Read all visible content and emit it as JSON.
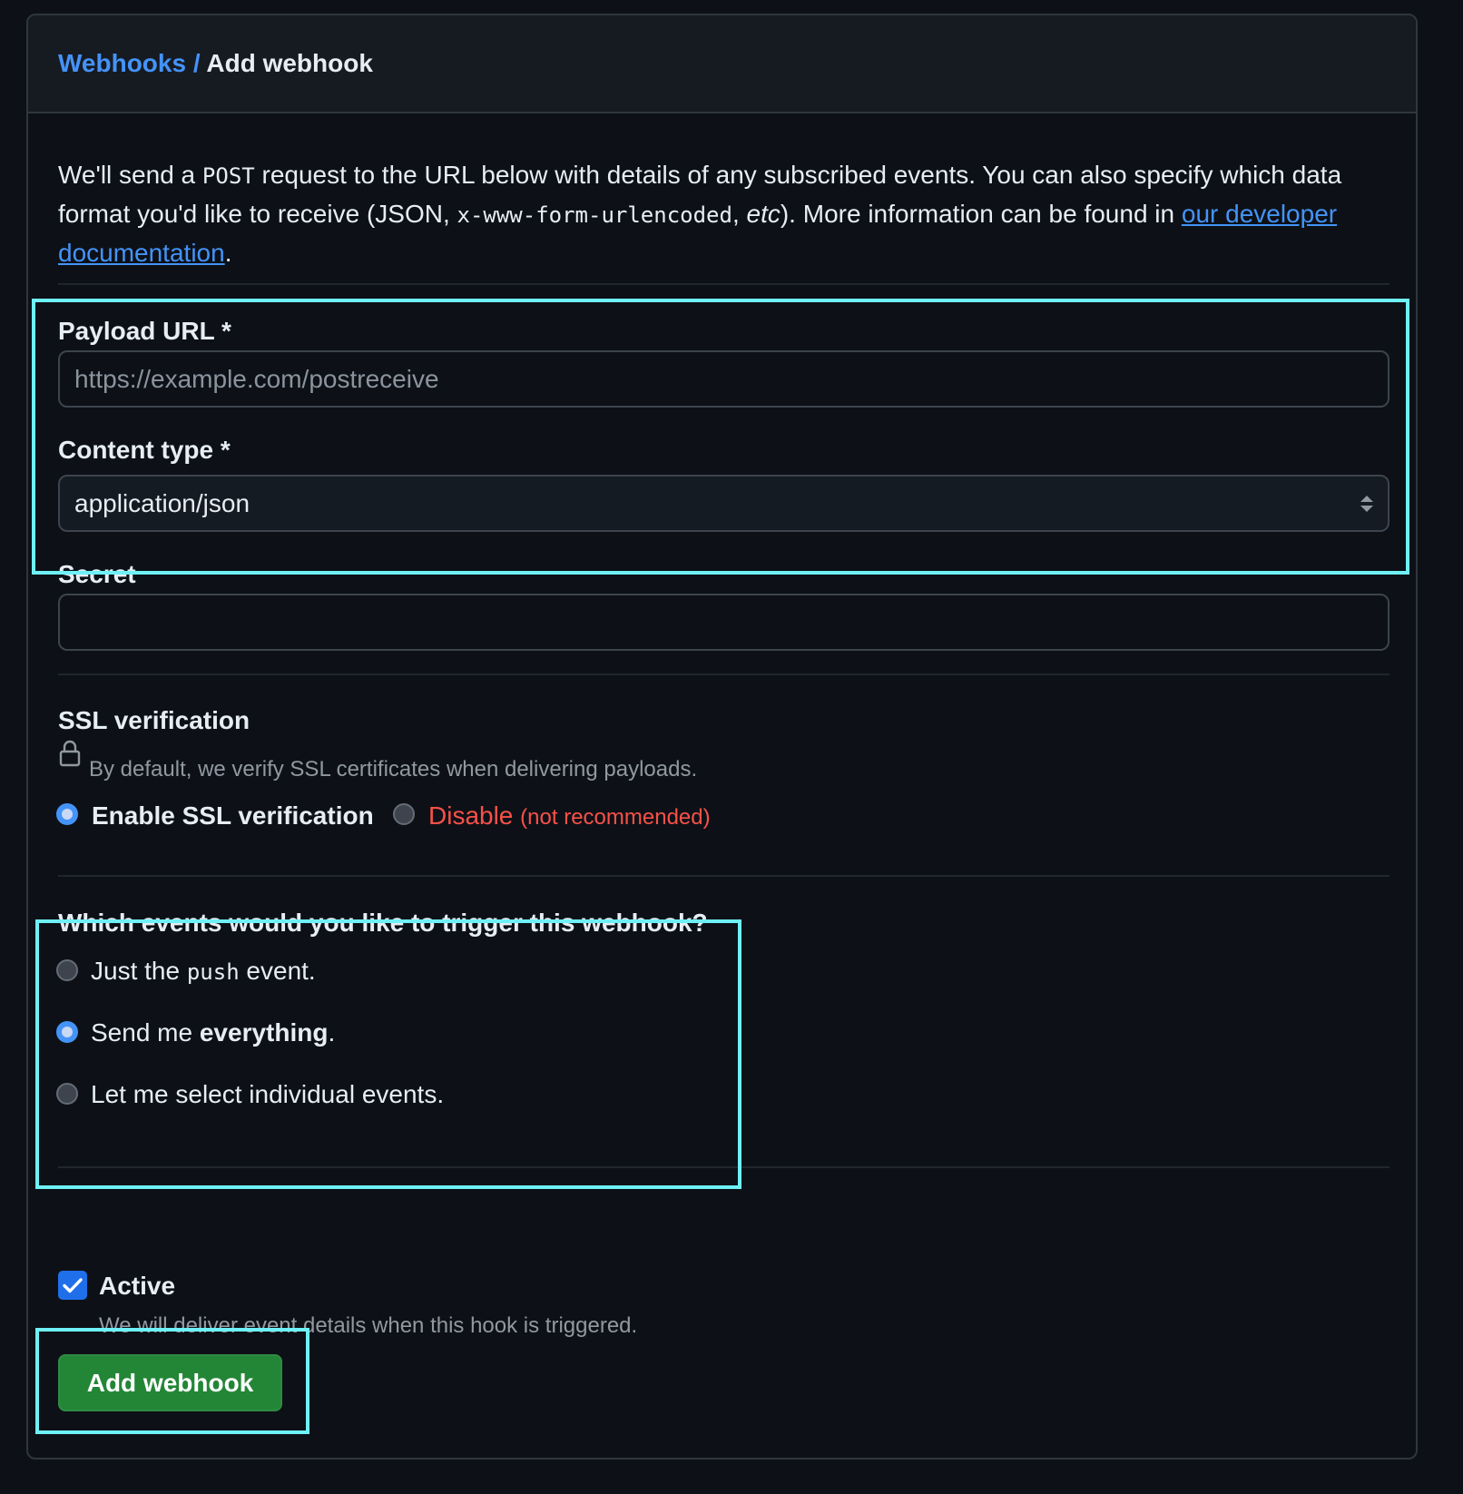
{
  "breadcrumb": {
    "parent": "Webhooks",
    "separator": "/",
    "current": "Add webhook"
  },
  "intro": {
    "part1": "We'll send a ",
    "code1": "POST",
    "part2": " request to the URL below with details of any subscribed events. You can also specify which data format you'd like to receive (JSON, ",
    "code2": "x-www-form-urlencoded",
    "part3": ", ",
    "italic": "etc",
    "part4": "). More information can be found in ",
    "link": "our developer documentation",
    "part5": "."
  },
  "payload_url": {
    "label": "Payload URL *",
    "placeholder": "https://example.com/postreceive",
    "value": ""
  },
  "content_type": {
    "label": "Content type *",
    "selected": "application/json"
  },
  "secret": {
    "label": "Secret",
    "value": ""
  },
  "ssl": {
    "title": "SSL verification",
    "note": "By default, we verify SSL certificates when delivering payloads.",
    "enable_label": "Enable SSL verification",
    "disable_label": "Disable",
    "disable_note": "(not recommended)",
    "selected": "enable"
  },
  "events": {
    "title": "Which events would you like to trigger this webhook?",
    "push_prefix": "Just the ",
    "push_code": "push",
    "push_suffix": " event.",
    "everything_prefix": "Send me ",
    "everything_bold": "everything",
    "everything_suffix": ".",
    "individual_label": "Let me select individual events.",
    "selected": "everything"
  },
  "active": {
    "label": "Active",
    "checked": true,
    "note": "We will deliver event details when this hook is triggered."
  },
  "submit": {
    "label": "Add webhook"
  },
  "colors": {
    "link": "#4493f8",
    "danger": "#f85149",
    "primary_button": "#238636",
    "highlight": "#6ef0f7"
  },
  "icons": [
    "lock-icon",
    "select-arrows-icon",
    "checkmark-icon"
  ]
}
